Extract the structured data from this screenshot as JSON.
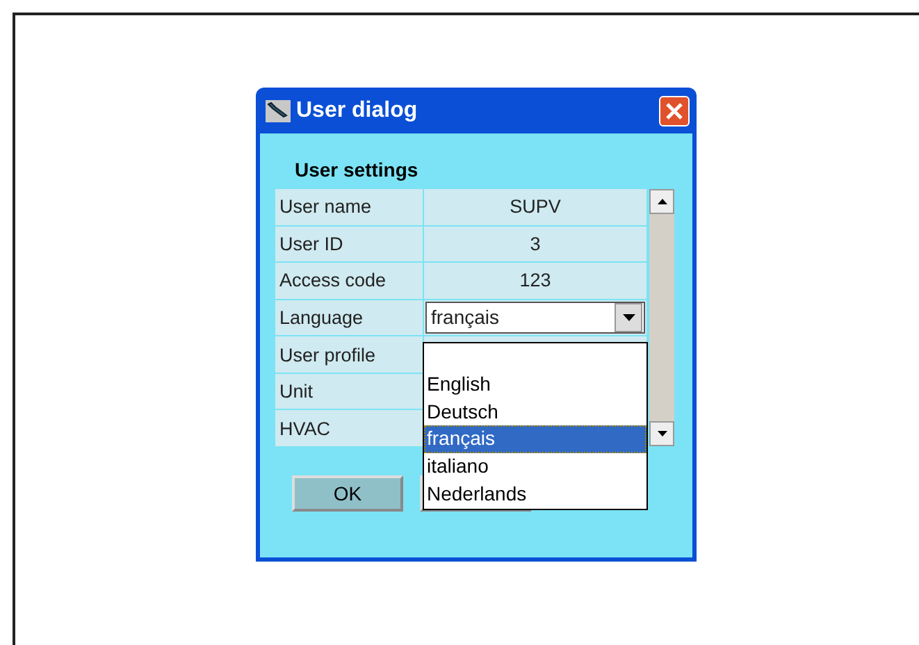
{
  "window": {
    "title": "User dialog"
  },
  "section_title": "User settings",
  "rows": [
    {
      "label": "User name",
      "kind": "text",
      "value": "SUPV"
    },
    {
      "label": "User ID",
      "kind": "text",
      "value": "3"
    },
    {
      "label": "Access code",
      "kind": "text",
      "value": "123"
    },
    {
      "label": "Language",
      "kind": "dropdown",
      "value": "français"
    },
    {
      "label": "User profile",
      "kind": "covered"
    },
    {
      "label": "Unit",
      "kind": "covered"
    },
    {
      "label": "HVAC",
      "kind": "covered"
    }
  ],
  "dropdown_options": [
    {
      "label": "English",
      "selected": false
    },
    {
      "label": "Deutsch",
      "selected": false
    },
    {
      "label": "français",
      "selected": true
    },
    {
      "label": "italiano",
      "selected": false
    },
    {
      "label": "Nederlands",
      "selected": false
    }
  ],
  "buttons": [
    {
      "label": "OK",
      "kind": "labeled"
    },
    {
      "kind": "covered"
    }
  ]
}
